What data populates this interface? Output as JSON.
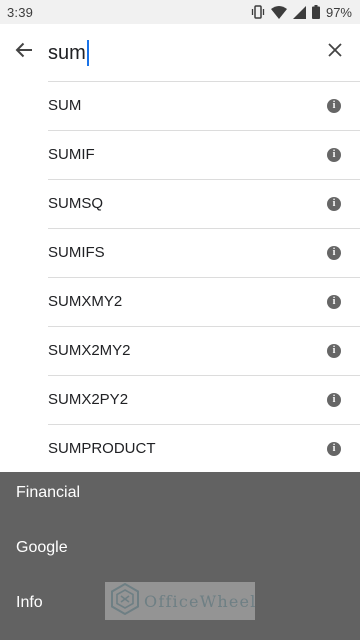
{
  "status_bar": {
    "time": "3:39",
    "battery": "97%",
    "icons": [
      "vibrate-icon",
      "wifi-icon",
      "signal-icon",
      "battery-icon"
    ]
  },
  "search": {
    "query": "sum"
  },
  "suggestions": [
    {
      "label": "SUM"
    },
    {
      "label": "SUMIF"
    },
    {
      "label": "SUMSQ"
    },
    {
      "label": "SUMIFS"
    },
    {
      "label": "SUMXMY2"
    },
    {
      "label": "SUMX2MY2"
    },
    {
      "label": "SUMX2PY2"
    },
    {
      "label": "SUMPRODUCT"
    }
  ],
  "categories": [
    "Financial",
    "Google",
    "Info"
  ],
  "watermark": {
    "text": "OfficeWheel"
  },
  "colors": {
    "accent": "#1a73e8",
    "overlay": "#626262",
    "info_icon": "#666666"
  }
}
